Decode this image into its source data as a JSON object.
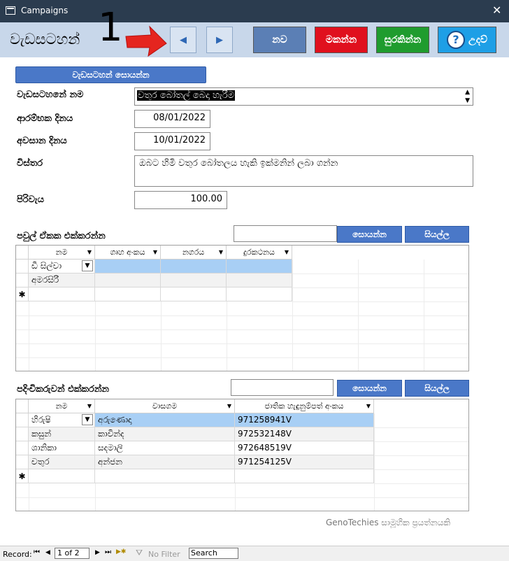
{
  "window": {
    "title": "Campaigns",
    "close": "✕"
  },
  "header": {
    "title": "වැඩසටහන්",
    "number": "1",
    "prev": "◀",
    "next": "▶",
    "new_label": "නව",
    "delete_label": "මකන්න",
    "save_label": "සුරකින්න",
    "help_label": "උදව්",
    "help_glyph": "?"
  },
  "form": {
    "search_campaign_label": "වැඩසටහන් සොයන්න",
    "name_label": "වැඩසටහනේ නම",
    "name_value": "වතුර බෝතල් බෙදා හැරීම",
    "start_label": "ආරම්භක දිනය",
    "start_value": "08/01/2022",
    "end_label": "අවසාන දිනය",
    "end_value": "10/01/2022",
    "desc_label": "විස්තර",
    "desc_value": "ඔබට හිමි වතුර බෝතලය හැකි ඉක්මනින් ලබා ගන්න",
    "cost_label": "පිරිවැය",
    "cost_value": "100.00"
  },
  "families": {
    "title": "පවුල් ඒකක එක්කරන්න",
    "search_btn": "සොයන්න",
    "all_btn": "සියල්ල",
    "columns": [
      "නම",
      "ගෘහ අංකය",
      "නගරය",
      "දුරකථනය"
    ],
    "rows": [
      [
        "ඩී සිල්වා",
        "",
        "",
        ""
      ],
      [
        "අමරසිරි",
        "",
        "",
        ""
      ]
    ],
    "new_marker": "✱"
  },
  "people": {
    "title": "පදිංචිකරුවන් එක්කරන්න",
    "search_btn": "සොයන්න",
    "all_btn": "සියල්ල",
    "columns": [
      "නම",
      "වාසගම",
      "ජාතික හැඳුනුම්පත් අංකය"
    ],
    "rows": [
      [
        "හිරුෂි",
        "අරුණොදා",
        "971258941V"
      ],
      [
        "කසුන්",
        "කාවින්ද",
        "972532148V"
      ],
      [
        "ශානිකා",
        "සදමාලි",
        "972648519V"
      ],
      [
        "චතුර",
        "අන්ජන",
        "971254125V"
      ]
    ],
    "new_marker": "✱"
  },
  "footer_note": "GenoTechies සාමූහික ප්‍රයත්නයකි",
  "statusbar": {
    "record_label": "Record:",
    "first": "⏮",
    "prev": "◀",
    "record_value": "1 of 2",
    "next": "▶",
    "last": "⏭",
    "new": "▶✱",
    "filter_label": "No Filter",
    "search_label": "Search"
  },
  "colors": {
    "new": "#5b7fb5",
    "delete": "#e0101e",
    "save": "#1f9c2e",
    "help": "#1e9fe6"
  }
}
